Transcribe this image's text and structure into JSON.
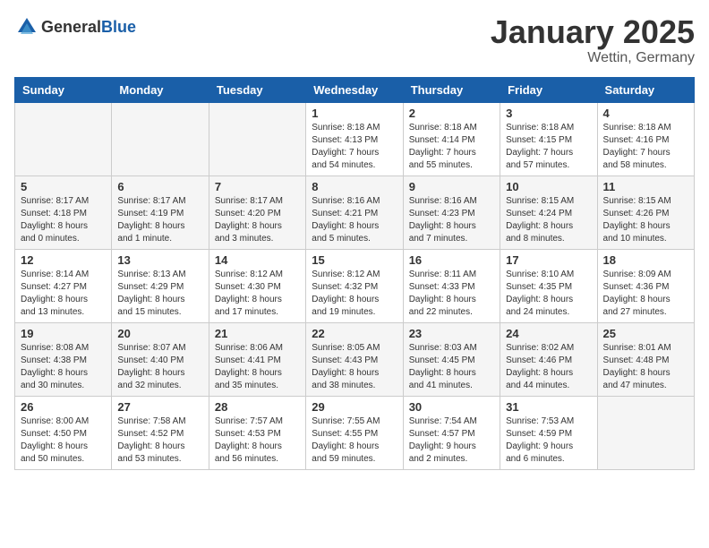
{
  "logo": {
    "text_general": "General",
    "text_blue": "Blue"
  },
  "header": {
    "month": "January 2025",
    "location": "Wettin, Germany"
  },
  "weekdays": [
    "Sunday",
    "Monday",
    "Tuesday",
    "Wednesday",
    "Thursday",
    "Friday",
    "Saturday"
  ],
  "weeks": [
    {
      "shaded": false,
      "days": [
        {
          "number": "",
          "info": ""
        },
        {
          "number": "",
          "info": ""
        },
        {
          "number": "",
          "info": ""
        },
        {
          "number": "1",
          "info": "Sunrise: 8:18 AM\nSunset: 4:13 PM\nDaylight: 7 hours\nand 54 minutes."
        },
        {
          "number": "2",
          "info": "Sunrise: 8:18 AM\nSunset: 4:14 PM\nDaylight: 7 hours\nand 55 minutes."
        },
        {
          "number": "3",
          "info": "Sunrise: 8:18 AM\nSunset: 4:15 PM\nDaylight: 7 hours\nand 57 minutes."
        },
        {
          "number": "4",
          "info": "Sunrise: 8:18 AM\nSunset: 4:16 PM\nDaylight: 7 hours\nand 58 minutes."
        }
      ]
    },
    {
      "shaded": true,
      "days": [
        {
          "number": "5",
          "info": "Sunrise: 8:17 AM\nSunset: 4:18 PM\nDaylight: 8 hours\nand 0 minutes."
        },
        {
          "number": "6",
          "info": "Sunrise: 8:17 AM\nSunset: 4:19 PM\nDaylight: 8 hours\nand 1 minute."
        },
        {
          "number": "7",
          "info": "Sunrise: 8:17 AM\nSunset: 4:20 PM\nDaylight: 8 hours\nand 3 minutes."
        },
        {
          "number": "8",
          "info": "Sunrise: 8:16 AM\nSunset: 4:21 PM\nDaylight: 8 hours\nand 5 minutes."
        },
        {
          "number": "9",
          "info": "Sunrise: 8:16 AM\nSunset: 4:23 PM\nDaylight: 8 hours\nand 7 minutes."
        },
        {
          "number": "10",
          "info": "Sunrise: 8:15 AM\nSunset: 4:24 PM\nDaylight: 8 hours\nand 8 minutes."
        },
        {
          "number": "11",
          "info": "Sunrise: 8:15 AM\nSunset: 4:26 PM\nDaylight: 8 hours\nand 10 minutes."
        }
      ]
    },
    {
      "shaded": false,
      "days": [
        {
          "number": "12",
          "info": "Sunrise: 8:14 AM\nSunset: 4:27 PM\nDaylight: 8 hours\nand 13 minutes."
        },
        {
          "number": "13",
          "info": "Sunrise: 8:13 AM\nSunset: 4:29 PM\nDaylight: 8 hours\nand 15 minutes."
        },
        {
          "number": "14",
          "info": "Sunrise: 8:12 AM\nSunset: 4:30 PM\nDaylight: 8 hours\nand 17 minutes."
        },
        {
          "number": "15",
          "info": "Sunrise: 8:12 AM\nSunset: 4:32 PM\nDaylight: 8 hours\nand 19 minutes."
        },
        {
          "number": "16",
          "info": "Sunrise: 8:11 AM\nSunset: 4:33 PM\nDaylight: 8 hours\nand 22 minutes."
        },
        {
          "number": "17",
          "info": "Sunrise: 8:10 AM\nSunset: 4:35 PM\nDaylight: 8 hours\nand 24 minutes."
        },
        {
          "number": "18",
          "info": "Sunrise: 8:09 AM\nSunset: 4:36 PM\nDaylight: 8 hours\nand 27 minutes."
        }
      ]
    },
    {
      "shaded": true,
      "days": [
        {
          "number": "19",
          "info": "Sunrise: 8:08 AM\nSunset: 4:38 PM\nDaylight: 8 hours\nand 30 minutes."
        },
        {
          "number": "20",
          "info": "Sunrise: 8:07 AM\nSunset: 4:40 PM\nDaylight: 8 hours\nand 32 minutes."
        },
        {
          "number": "21",
          "info": "Sunrise: 8:06 AM\nSunset: 4:41 PM\nDaylight: 8 hours\nand 35 minutes."
        },
        {
          "number": "22",
          "info": "Sunrise: 8:05 AM\nSunset: 4:43 PM\nDaylight: 8 hours\nand 38 minutes."
        },
        {
          "number": "23",
          "info": "Sunrise: 8:03 AM\nSunset: 4:45 PM\nDaylight: 8 hours\nand 41 minutes."
        },
        {
          "number": "24",
          "info": "Sunrise: 8:02 AM\nSunset: 4:46 PM\nDaylight: 8 hours\nand 44 minutes."
        },
        {
          "number": "25",
          "info": "Sunrise: 8:01 AM\nSunset: 4:48 PM\nDaylight: 8 hours\nand 47 minutes."
        }
      ]
    },
    {
      "shaded": false,
      "days": [
        {
          "number": "26",
          "info": "Sunrise: 8:00 AM\nSunset: 4:50 PM\nDaylight: 8 hours\nand 50 minutes."
        },
        {
          "number": "27",
          "info": "Sunrise: 7:58 AM\nSunset: 4:52 PM\nDaylight: 8 hours\nand 53 minutes."
        },
        {
          "number": "28",
          "info": "Sunrise: 7:57 AM\nSunset: 4:53 PM\nDaylight: 8 hours\nand 56 minutes."
        },
        {
          "number": "29",
          "info": "Sunrise: 7:55 AM\nSunset: 4:55 PM\nDaylight: 8 hours\nand 59 minutes."
        },
        {
          "number": "30",
          "info": "Sunrise: 7:54 AM\nSunset: 4:57 PM\nDaylight: 9 hours\nand 2 minutes."
        },
        {
          "number": "31",
          "info": "Sunrise: 7:53 AM\nSunset: 4:59 PM\nDaylight: 9 hours\nand 6 minutes."
        },
        {
          "number": "",
          "info": ""
        }
      ]
    }
  ]
}
